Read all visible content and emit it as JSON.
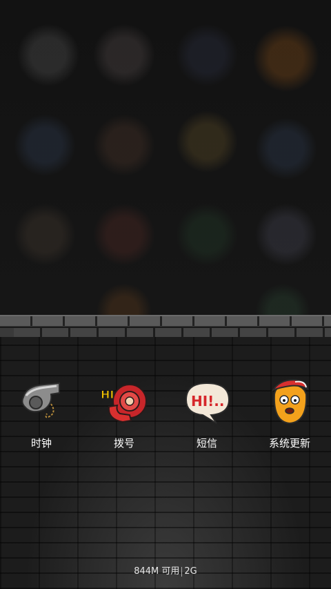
{
  "apps": [
    {
      "label": "时钟",
      "icon": "whistle-icon"
    },
    {
      "label": "拨号",
      "icon": "phone-hi-icon"
    },
    {
      "label": "短信",
      "icon": "speech-bubble-hi-icon"
    },
    {
      "label": "系统更新",
      "icon": "cartoon-face-icon"
    }
  ],
  "icon_text": {
    "dialer": "HI",
    "sms": "HI!.."
  },
  "status": {
    "memory": "844M 可用",
    "network": "2G"
  }
}
